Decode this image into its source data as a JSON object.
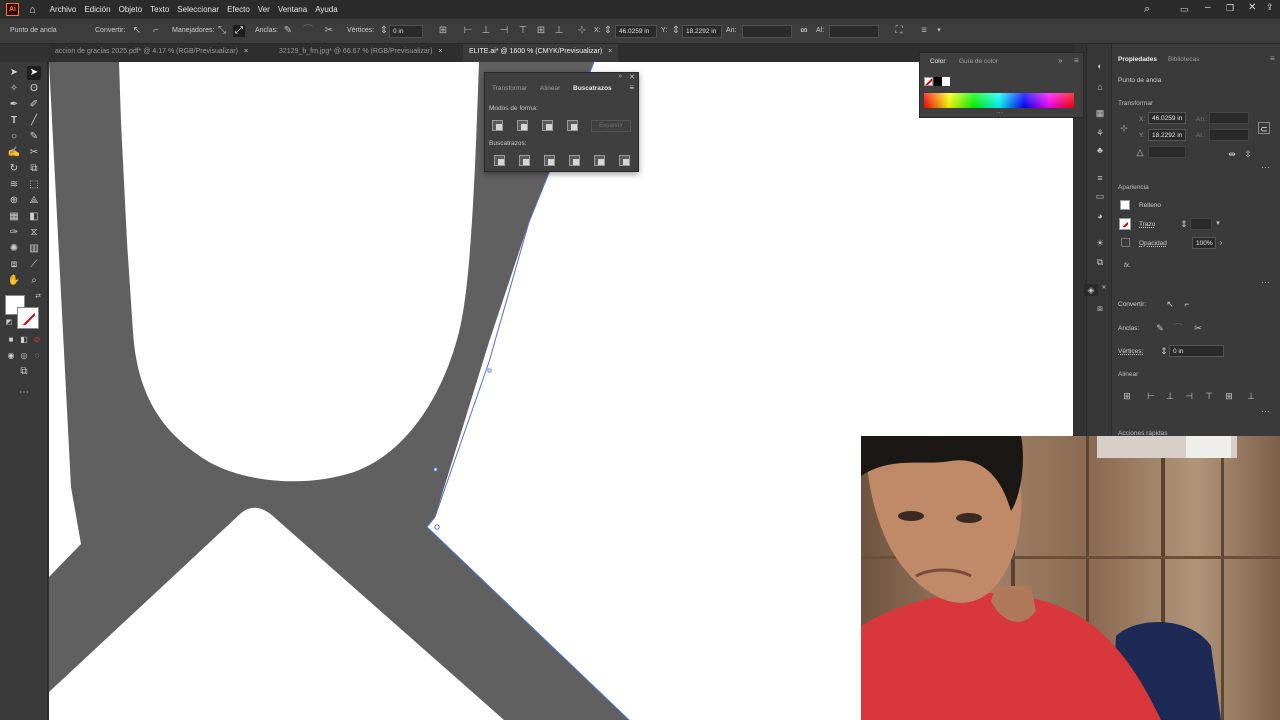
{
  "app": {
    "logo": "Ai"
  },
  "menubar": {
    "items": [
      "Archivo",
      "Edición",
      "Objeto",
      "Texto",
      "Seleccionar",
      "Efecto",
      "Ver",
      "Ventana",
      "Ayuda"
    ]
  },
  "controlbar": {
    "selection": "Punto de ancla",
    "convertir": "Convertir:",
    "manejadores": "Manejadores:",
    "anclas": "Anclas:",
    "vertices": "Vértices:",
    "vertices_value": "0 in",
    "x_label": "X:",
    "x_value": "46.0259 in",
    "y_label": "Y:",
    "y_value": "18.2292 in",
    "an_label": "An:",
    "al_label": "Al:"
  },
  "tabs": [
    {
      "label": "accion de gracias 2025.pdf* @ 4.17 % (RGB/Previsualizar)",
      "active": false
    },
    {
      "label": "32129_b_fm.jpg* @ 66.67 % (RGB/Previsualizar)",
      "active": false
    },
    {
      "label": "ELITE.ai* @ 1600 % (CMYK/Previsualizar)",
      "active": true
    }
  ],
  "tab_close_glyph": "×",
  "pathfinder": {
    "tabs": [
      "Transformar",
      "Alinear",
      "Buscatrazos"
    ],
    "active_tab": "Buscatrazos",
    "shape_modes_label": "Modos de forma:",
    "expand_label": "Expandir",
    "pathfinders_label": "Buscatrazos:"
  },
  "color_panel": {
    "tabs": [
      "Color",
      "Guía de color"
    ],
    "active_tab": "Color"
  },
  "properties": {
    "tabs": [
      "Propiedades",
      "Bibliotecas"
    ],
    "selection": "Punto de ancla",
    "transform_label": "Transformar",
    "x_label": "X:",
    "x_value": "46.0259 in",
    "y_label": "Y:",
    "y_value": "18.2292 in",
    "an_label": "An.:",
    "al_label": "Al.:",
    "appearance_label": "Apariencia",
    "fill_label": "Relleno",
    "stroke_label": "Trazo",
    "opacity_label": "Opacidad",
    "opacity_value": "100%",
    "fx_label": "fx.",
    "convertir_label": "Convertir:",
    "anclas_label": "Anclas:",
    "vertices_label": "Vértices:",
    "vertices_value": "0 in",
    "align_label": "Alinear",
    "quick_actions_label": "Acciones rápidas"
  },
  "colors": {
    "artwork_gray": "#606060",
    "accent_blue": "#4a74d4",
    "menubar_bg": "#2b2b2b",
    "panel_bg": "#3a3a3a"
  }
}
